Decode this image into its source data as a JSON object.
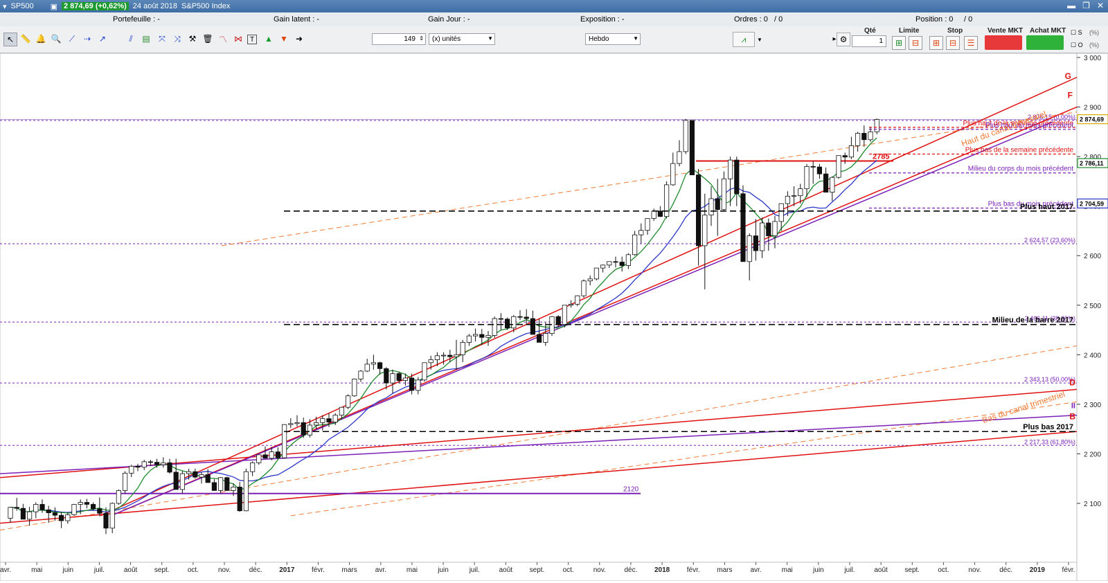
{
  "window": {
    "symbol": "SP500",
    "quote": "2 874,69 (+0,62%)",
    "date": "24 août 2018",
    "instrument": "S&P500 Index"
  },
  "infobar": {
    "portefeuille": "Portefeuille : -",
    "gain_latent": "Gain latent : -",
    "gain_jour": "Gain Jour : -",
    "exposition": "Exposition : -",
    "ordres": "Ordres : 0",
    "ordres_count": "/ 0",
    "position": "Position : 0",
    "position_count": "/ 0"
  },
  "toolbar": {
    "quantity": "149",
    "unit": "(x) unités",
    "period": "Hebdo",
    "qty_label": "Qté",
    "qty_value": "1",
    "limite_label": "Limite",
    "stop_label": "Stop",
    "vente_label": "Vente MKT",
    "achat_label": "Achat MKT",
    "s_label": "S",
    "o_label": "O",
    "s_pct": "(%)",
    "o_pct": "(%)"
  },
  "chart_data": {
    "type": "candlestick",
    "ylim": [
      2075,
      3000
    ],
    "y_ticks": [
      3000,
      2900,
      2800,
      2700,
      2600,
      2500,
      2400,
      2300,
      2200,
      2100
    ],
    "y_tick_labels": [
      "3 000",
      "2 900",
      "2 800",
      "2 700",
      "2 600",
      "2 500",
      "2 400",
      "2 300",
      "2 200",
      "2 100"
    ],
    "x_labels": [
      "avr.",
      "mai",
      "juin",
      "juil.",
      "août",
      "sept.",
      "oct.",
      "nov.",
      "déc.",
      "2017",
      "févr.",
      "mars",
      "avr.",
      "mai",
      "juin",
      "juil.",
      "août",
      "sept.",
      "oct.",
      "nov.",
      "déc.",
      "2018",
      "févr.",
      "mars",
      "avr.",
      "mai",
      "juin",
      "juil.",
      "août",
      "sept.",
      "oct.",
      "nov.",
      "déc.",
      "2019",
      "févr."
    ],
    "price_badges": [
      {
        "label": "2 874,69",
        "value": 2874.69,
        "color": "#d4a800"
      },
      {
        "label": "2 786,11",
        "value": 2786.11,
        "color": "#1d8a2c"
      },
      {
        "label": "2 704,59",
        "value": 2704.59,
        "color": "#2a36c8"
      }
    ],
    "horizontal_levels": [
      {
        "label": "Plus haut de la semaine précédente",
        "value": 2859,
        "color": "#e01010"
      },
      {
        "label": "Plus haut du mois précédent",
        "value": 2855,
        "color": "#7a1fb8"
      },
      {
        "label": "Plus bas de la semaine précédente",
        "value": 2805,
        "color": "#e01010"
      },
      {
        "label": "Milieu du corps du mois précédent",
        "value": 2767,
        "color": "#7a1fb8"
      },
      {
        "label": "Plus bas du mois précédent",
        "value": 2696,
        "color": "#7a1fb8"
      },
      {
        "label": "Plus haut 2017",
        "value": 2690,
        "color": "#000000"
      },
      {
        "label": "Milieu de la barre 2017",
        "value": 2461,
        "color": "#000000"
      },
      {
        "label": "Plus bas 2017",
        "value": 2245,
        "color": "#000000"
      }
    ],
    "fib_levels": [
      {
        "label": "2 876,15 (0,00%)",
        "value": 2873
      },
      {
        "label": "2 624,57 (23,60%)",
        "value": 2624
      },
      {
        "label": "2 466,11 (38,20%)",
        "value": 2466
      },
      {
        "label": "2 343,13 (50,00%)",
        "value": 2343
      },
      {
        "label": "2 217,33 (61,80%)",
        "value": 2217
      }
    ],
    "annotations": [
      {
        "text": "2785",
        "value": 2791,
        "color": "#e01010"
      },
      {
        "text": "2120",
        "value": 2120,
        "color": "#7a1fb8"
      },
      {
        "text": "Haut du canal trimestriel",
        "color": "#f07830"
      },
      {
        "text": "Bas du canal trimestriel",
        "color": "#f07830"
      },
      {
        "text": "G",
        "color": "#e01010"
      },
      {
        "text": "F",
        "color": "#e01010"
      },
      {
        "text": "D",
        "color": "#e01010"
      },
      {
        "text": "II",
        "color": "#7a1fb8"
      },
      {
        "text": "B",
        "color": "#e01010"
      }
    ],
    "candles": [
      [
        2070,
        2093,
        2061,
        2092
      ],
      [
        2092,
        2111,
        2085,
        2090
      ],
      [
        2090,
        2099,
        2070,
        2068
      ],
      [
        2068,
        2093,
        2055,
        2083
      ],
      [
        2083,
        2102,
        2070,
        2098
      ],
      [
        2098,
        2108,
        2081,
        2087
      ],
      [
        2087,
        2095,
        2061,
        2081
      ],
      [
        2081,
        2092,
        2065,
        2076
      ],
      [
        2076,
        2083,
        2050,
        2065
      ],
      [
        2065,
        2082,
        2059,
        2077
      ],
      [
        2077,
        2099,
        2075,
        2098
      ],
      [
        2098,
        2108,
        2078,
        2102
      ],
      [
        2102,
        2109,
        2090,
        2098
      ],
      [
        2098,
        2102,
        2085,
        2089
      ],
      [
        2089,
        2112,
        2074,
        2080
      ],
      [
        2080,
        2092,
        2038,
        2050
      ],
      [
        2050,
        2102,
        2040,
        2100
      ],
      [
        2100,
        2128,
        2097,
        2126
      ],
      [
        2126,
        2165,
        2120,
        2161
      ],
      [
        2161,
        2178,
        2153,
        2175
      ],
      [
        2175,
        2180,
        2165,
        2173
      ],
      [
        2173,
        2188,
        2167,
        2184
      ],
      [
        2184,
        2188,
        2175,
        2183
      ],
      [
        2183,
        2190,
        2172,
        2178
      ],
      [
        2178,
        2193,
        2172,
        2182
      ],
      [
        2182,
        2190,
        2160,
        2163
      ],
      [
        2163,
        2190,
        2130,
        2128
      ],
      [
        2128,
        2165,
        2120,
        2160
      ],
      [
        2160,
        2170,
        2148,
        2164
      ],
      [
        2164,
        2170,
        2150,
        2153
      ],
      [
        2153,
        2163,
        2140,
        2158
      ],
      [
        2158,
        2169,
        2143,
        2142
      ],
      [
        2142,
        2149,
        2130,
        2126
      ],
      [
        2126,
        2153,
        2120,
        2152
      ],
      [
        2152,
        2154,
        2125,
        2126
      ],
      [
        2126,
        2140,
        2115,
        2133
      ],
      [
        2133,
        2143,
        2083,
        2085
      ],
      [
        2085,
        2170,
        2084,
        2164
      ],
      [
        2164,
        2185,
        2155,
        2182
      ],
      [
        2182,
        2198,
        2178,
        2198
      ],
      [
        2198,
        2215,
        2192,
        2191
      ],
      [
        2191,
        2214,
        2187,
        2204
      ],
      [
        2204,
        2213,
        2190,
        2192
      ],
      [
        2192,
        2260,
        2190,
        2259
      ],
      [
        2259,
        2272,
        2252,
        2261
      ],
      [
        2261,
        2278,
        2255,
        2263
      ],
      [
        2263,
        2273,
        2232,
        2238
      ],
      [
        2238,
        2270,
        2233,
        2258
      ],
      [
        2258,
        2275,
        2250,
        2263
      ],
      [
        2263,
        2278,
        2247,
        2271
      ],
      [
        2271,
        2282,
        2254,
        2264
      ],
      [
        2264,
        2282,
        2258,
        2278
      ],
      [
        2278,
        2293,
        2270,
        2294
      ],
      [
        2294,
        2320,
        2290,
        2317
      ],
      [
        2317,
        2352,
        2315,
        2351
      ],
      [
        2351,
        2369,
        2345,
        2367
      ],
      [
        2367,
        2392,
        2365,
        2381
      ],
      [
        2381,
        2400,
        2370,
        2384
      ],
      [
        2384,
        2386,
        2360,
        2372
      ],
      [
        2372,
        2375,
        2330,
        2343
      ],
      [
        2343,
        2370,
        2322,
        2362
      ],
      [
        2362,
        2366,
        2342,
        2348
      ],
      [
        2348,
        2362,
        2338,
        2353
      ],
      [
        2353,
        2362,
        2320,
        2328
      ],
      [
        2328,
        2355,
        2320,
        2349
      ],
      [
        2349,
        2377,
        2346,
        2384
      ],
      [
        2384,
        2398,
        2370,
        2390
      ],
      [
        2390,
        2405,
        2377,
        2398
      ],
      [
        2398,
        2405,
        2380,
        2399
      ],
      [
        2399,
        2410,
        2385,
        2396
      ],
      [
        2396,
        2430,
        2370,
        2400
      ],
      [
        2400,
        2430,
        2385,
        2425
      ],
      [
        2425,
        2442,
        2418,
        2438
      ],
      [
        2438,
        2453,
        2427,
        2441
      ],
      [
        2441,
        2452,
        2420,
        2435
      ],
      [
        2435,
        2448,
        2418,
        2439
      ],
      [
        2439,
        2477,
        2434,
        2473
      ],
      [
        2473,
        2484,
        2450,
        2472
      ],
      [
        2472,
        2475,
        2450,
        2454
      ],
      [
        2454,
        2480,
        2445,
        2477
      ],
      [
        2477,
        2490,
        2470,
        2476
      ],
      [
        2476,
        2492,
        2460,
        2473
      ],
      [
        2473,
        2489,
        2448,
        2441
      ],
      [
        2441,
        2472,
        2438,
        2425
      ],
      [
        2425,
        2465,
        2418,
        2443
      ],
      [
        2443,
        2478,
        2438,
        2477
      ],
      [
        2477,
        2480,
        2455,
        2461
      ],
      [
        2461,
        2500,
        2455,
        2500
      ],
      [
        2500,
        2510,
        2495,
        2502
      ],
      [
        2502,
        2520,
        2498,
        2519
      ],
      [
        2519,
        2552,
        2515,
        2549
      ],
      [
        2549,
        2560,
        2540,
        2553
      ],
      [
        2553,
        2575,
        2550,
        2575
      ],
      [
        2575,
        2582,
        2566,
        2581
      ],
      [
        2581,
        2588,
        2575,
        2588
      ],
      [
        2588,
        2598,
        2576,
        2587
      ],
      [
        2587,
        2598,
        2568,
        2580
      ],
      [
        2580,
        2605,
        2573,
        2602
      ],
      [
        2602,
        2650,
        2600,
        2642
      ],
      [
        2642,
        2665,
        2625,
        2651
      ],
      [
        2651,
        2675,
        2642,
        2675
      ],
      [
        2675,
        2695,
        2670,
        2690
      ],
      [
        2690,
        2700,
        2678,
        2679
      ],
      [
        2679,
        2750,
        2675,
        2743
      ],
      [
        2743,
        2808,
        2741,
        2786
      ],
      [
        2786,
        2833,
        2780,
        2810
      ],
      [
        2810,
        2876,
        2805,
        2873
      ],
      [
        2873,
        2870,
        2800,
        2763
      ],
      [
        2763,
        2775,
        2580,
        2620
      ],
      [
        2620,
        2725,
        2532,
        2682
      ],
      [
        2682,
        2740,
        2660,
        2715
      ],
      [
        2715,
        2755,
        2640,
        2693
      ],
      [
        2693,
        2770,
        2690,
        2755
      ],
      [
        2755,
        2800,
        2700,
        2793
      ],
      [
        2793,
        2800,
        2700,
        2725
      ],
      [
        2725,
        2742,
        2590,
        2588
      ],
      [
        2588,
        2645,
        2550,
        2640
      ],
      [
        2640,
        2674,
        2590,
        2610
      ],
      [
        2610,
        2677,
        2595,
        2666
      ],
      [
        2666,
        2675,
        2610,
        2640
      ],
      [
        2640,
        2680,
        2615,
        2669
      ],
      [
        2669,
        2705,
        2650,
        2705
      ],
      [
        2705,
        2730,
        2680,
        2720
      ],
      [
        2720,
        2740,
        2700,
        2721
      ],
      [
        2721,
        2745,
        2705,
        2735
      ],
      [
        2735,
        2785,
        2718,
        2780
      ],
      [
        2780,
        2791,
        2745,
        2779
      ],
      [
        2779,
        2785,
        2755,
        2765
      ],
      [
        2765,
        2778,
        2740,
        2728
      ],
      [
        2728,
        2760,
        2710,
        2758
      ],
      [
        2758,
        2801,
        2755,
        2802
      ],
      [
        2802,
        2808,
        2785,
        2799
      ],
      [
        2799,
        2840,
        2795,
        2822
      ],
      [
        2822,
        2850,
        2810,
        2847
      ],
      [
        2847,
        2863,
        2820,
        2834
      ],
      [
        2834,
        2860,
        2830,
        2850
      ],
      [
        2850,
        2877,
        2845,
        2875
      ]
    ]
  }
}
